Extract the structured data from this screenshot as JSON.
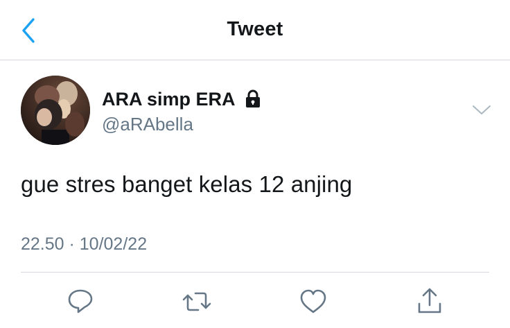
{
  "header": {
    "title": "Tweet",
    "back_icon": "chevron-left-icon"
  },
  "tweet": {
    "author": {
      "display_name": "ARA simp ERA",
      "handle": "@aRAbella",
      "protected_icon": "lock-icon",
      "avatar": "avatar-photo"
    },
    "text": "gue stres banget kelas 12 anjing",
    "timestamp": "22.50 · 10/02/22",
    "more_icon": "chevron-down-icon"
  },
  "actions": [
    {
      "name": "reply",
      "icon": "reply-icon"
    },
    {
      "name": "retweet",
      "icon": "retweet-icon"
    },
    {
      "name": "like",
      "icon": "heart-icon"
    },
    {
      "name": "share",
      "icon": "share-icon"
    }
  ],
  "colors": {
    "accent": "#1da1f2",
    "text_primary": "#14171a",
    "text_secondary": "#657786",
    "divider": "#d4d8dc"
  }
}
